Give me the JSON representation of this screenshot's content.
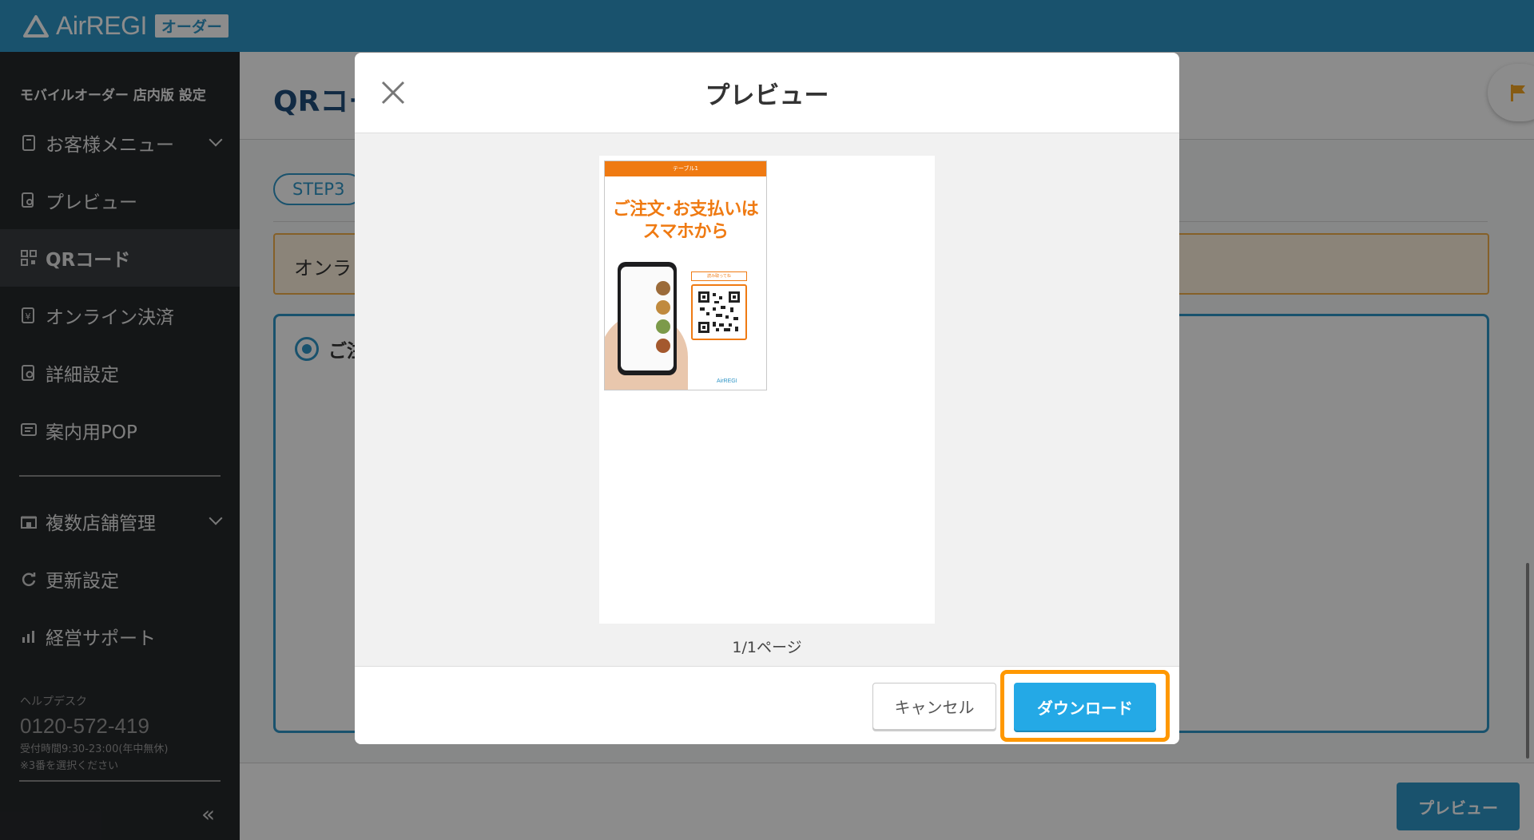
{
  "brand": {
    "name": "AirREGI",
    "badge": "オーダー"
  },
  "sidebar": {
    "section_title": "モバイルオーダー 店内版 設定",
    "items": [
      {
        "label": "お客様メニュー",
        "icon": "menu-book-icon",
        "has_chevron": true
      },
      {
        "label": "プレビュー",
        "icon": "preview-icon",
        "has_chevron": false
      },
      {
        "label": "QRコード",
        "icon": "qr-code-icon",
        "has_chevron": false,
        "active": true
      },
      {
        "label": "オンライン決済",
        "icon": "payment-icon",
        "has_chevron": false
      },
      {
        "label": "詳細設定",
        "icon": "settings-icon",
        "has_chevron": false
      },
      {
        "label": "案内用POP",
        "icon": "pop-icon",
        "has_chevron": false
      }
    ],
    "secondary_items": [
      {
        "label": "複数店舗管理",
        "icon": "store-icon",
        "has_chevron": true
      },
      {
        "label": "更新設定",
        "icon": "refresh-icon",
        "has_chevron": false
      },
      {
        "label": "経営サポート",
        "icon": "chart-icon",
        "has_chevron": false
      }
    ],
    "help": {
      "title": "ヘルプデスク",
      "tel": "0120-572-419",
      "hours": "受付時間9:30-23:00(年中無休)",
      "note": "※3番を選択ください"
    },
    "collapse_label": "«"
  },
  "main": {
    "page_title": "QRコー",
    "step_label": "STEP3",
    "notice_text": "オンラ",
    "option_label": "ご注",
    "preview_button": "プレビュー"
  },
  "modal": {
    "title": "プレビュー",
    "page_indicator": "1/1ページ",
    "cancel_label": "キャンセル",
    "download_label": "ダウンロード",
    "pop": {
      "table_label": "テーブル1",
      "headline_line1": "ご注文･お支払いは",
      "headline_line2": "スマホから",
      "qr_label": "読み取ってね",
      "logo_text": "AirREGI"
    }
  },
  "colors": {
    "header_blue": "#2f95c6",
    "sidebar_bg": "#26282b",
    "pop_orange": "#ef7a12",
    "download_blue": "#24a9e6",
    "highlight_orange": "#ff9800"
  }
}
